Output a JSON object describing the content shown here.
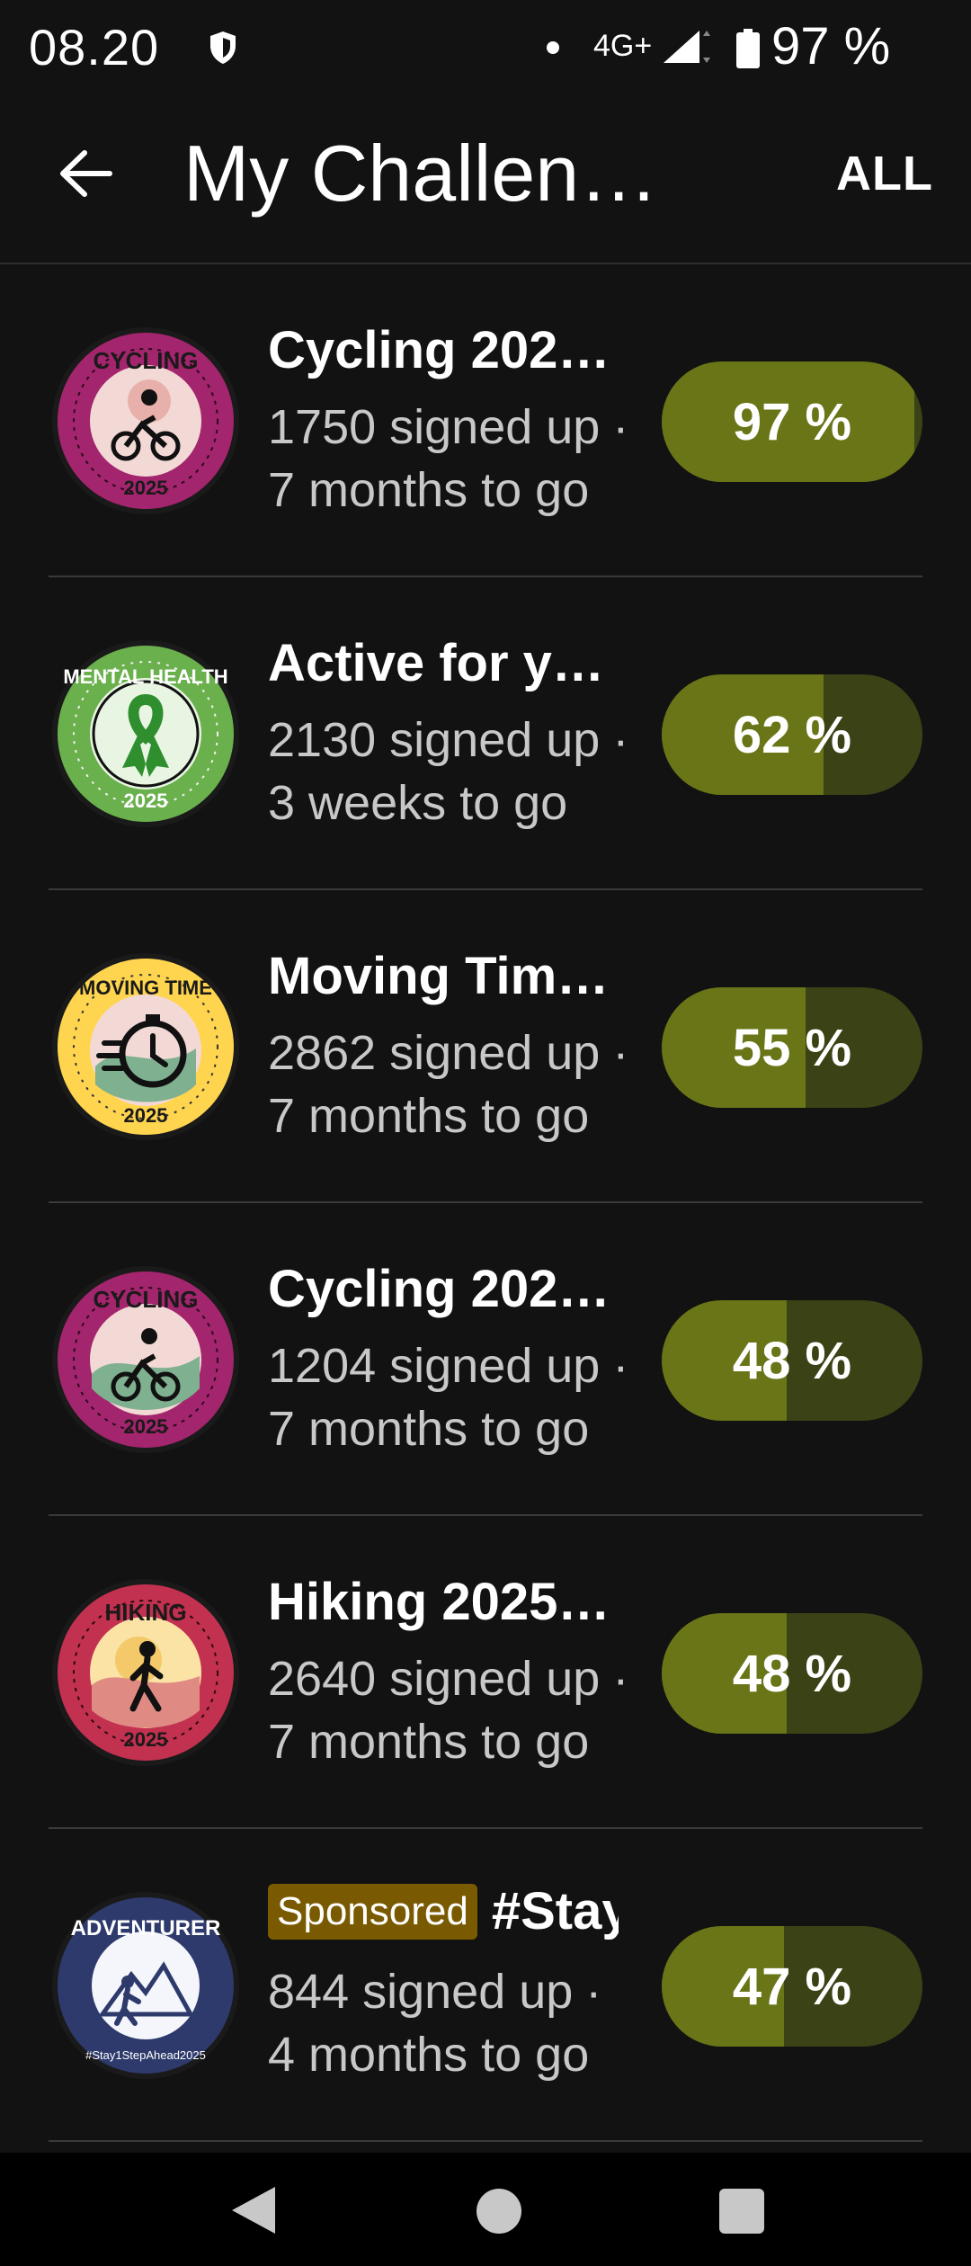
{
  "status_bar": {
    "time": "08.20",
    "network": "4G+",
    "battery": "97 %"
  },
  "app_bar": {
    "title": "My Challen…",
    "filter_label": "ALL"
  },
  "challenges": [
    {
      "badge": "cycling-2025-badge",
      "badge_top_text": "CYCLING",
      "badge_year": "2025",
      "name": "Cycling 202…",
      "signed_up": "1750 signed up",
      "time_left": "7 months to go",
      "progress_label": "97 %",
      "progress": 0.97
    },
    {
      "badge": "mental-health-2025-badge",
      "badge_top_text": "MENTAL HEALTH",
      "badge_year": "2025",
      "name": "Active for y…",
      "signed_up": "2130 signed up",
      "time_left": "3 weeks to go",
      "progress_label": "62 %",
      "progress": 0.62
    },
    {
      "badge": "moving-time-2025-badge",
      "badge_top_text": "MOVING TIME",
      "badge_year": "2025",
      "name": "Moving Tim…",
      "signed_up": "2862 signed up",
      "time_left": "7 months to go",
      "progress_label": "55 %",
      "progress": 0.55
    },
    {
      "badge": "cycling-2025-badge",
      "badge_top_text": "CYCLING",
      "badge_year": "2025",
      "name": "Cycling 202…",
      "signed_up": "1204 signed up",
      "time_left": "7 months to go",
      "progress_label": "48 %",
      "progress": 0.48
    },
    {
      "badge": "hiking-2025-badge",
      "badge_top_text": "HIKING",
      "badge_year": "2025",
      "name": "Hiking 2025…",
      "signed_up": "2640 signed up",
      "time_left": "7 months to go",
      "progress_label": "48 %",
      "progress": 0.48
    },
    {
      "badge": "adventurer-badge",
      "badge_top_text": "ADVENTURER",
      "badge_bottom_text": "#Stay1StepAhead2025",
      "sponsored_label": "Sponsored",
      "name": "#Stay",
      "signed_up": "844 signed up",
      "time_left": "4 months to go",
      "progress_label": "47 %",
      "progress": 0.47
    }
  ],
  "separator": "·",
  "colors": {
    "progress_fill": "#6a7517",
    "progress_track": "#3b4215",
    "sponsored_bg": "#7a5a00"
  }
}
